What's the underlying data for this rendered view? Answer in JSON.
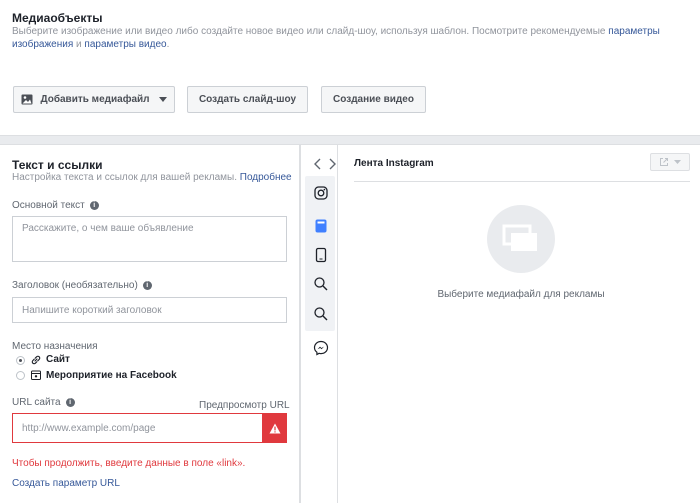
{
  "media": {
    "title": "Медиаобъекты",
    "desc_text": "Выберите изображение или видео либо создайте новое видео или слайд-шоу, используя шаблон. Посмотрите рекомендуемые ",
    "desc_link1": "параметры изображения",
    "desc_and": " и ",
    "desc_link2": "параметры видео",
    "desc_end": ".",
    "add_media_button": "Добавить медиафайл",
    "slideshow_button": "Создать слайд-шоу",
    "video_button": "Создание видео"
  },
  "text_links": {
    "title": "Текст и ссылки",
    "desc": "Настройка текста и ссылок для вашей рекламы. ",
    "desc_link": "Подробнее",
    "primary_text_label": "Основной текст",
    "primary_text_placeholder": "Расскажите, о чем ваше объявление",
    "headline_label": "Заголовок (необязательно)",
    "headline_placeholder": "Напишите короткий заголовок",
    "destination_label": "Место назначения",
    "option_site": "Сайт",
    "option_event": "Мероприятие на Facebook",
    "url_label": "URL сайта",
    "url_preview": "Предпросмотр URL",
    "url_placeholder": "http://www.example.com/page",
    "error_text": "Чтобы продолжить, введите данные в поле «link».",
    "create_param_link": "Создать параметр URL"
  },
  "preview": {
    "title": "Лента Instagram",
    "empty_text": "Выберите медиафайл для рекламы"
  },
  "colors": {
    "link": "#365899",
    "error": "#e0393e",
    "active_tool": "#4080ff"
  }
}
